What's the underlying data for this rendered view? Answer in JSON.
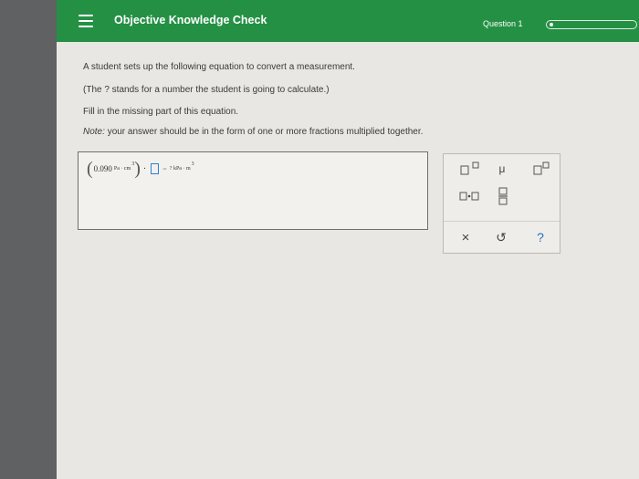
{
  "header": {
    "title": "Objective Knowledge Check",
    "question_label": "Question 1",
    "progress": 0.02
  },
  "prompt": {
    "line1": "A student sets up the following equation to convert a measurement.",
    "line2": "(The ? stands for a number the student is going to calculate.)",
    "line3": "Fill in the missing part of this equation.",
    "note_label": "Note:",
    "note_text": "your answer should be in the form of one or more fractions multiplied together."
  },
  "equation": {
    "value": "0.090",
    "left_units": "Pa · cm",
    "left_exp": "3",
    "equals": "=",
    "result": "? kPa · m",
    "result_exp": "3"
  },
  "palette": {
    "sci_label": "x10",
    "mu_label": "μ",
    "dot_label": "·",
    "clear_label": "×",
    "undo_label": "↺",
    "help_label": "?"
  },
  "colors": {
    "header": "#249044",
    "page": "#e9e7e3",
    "blank_border": "#2f7fd6"
  }
}
